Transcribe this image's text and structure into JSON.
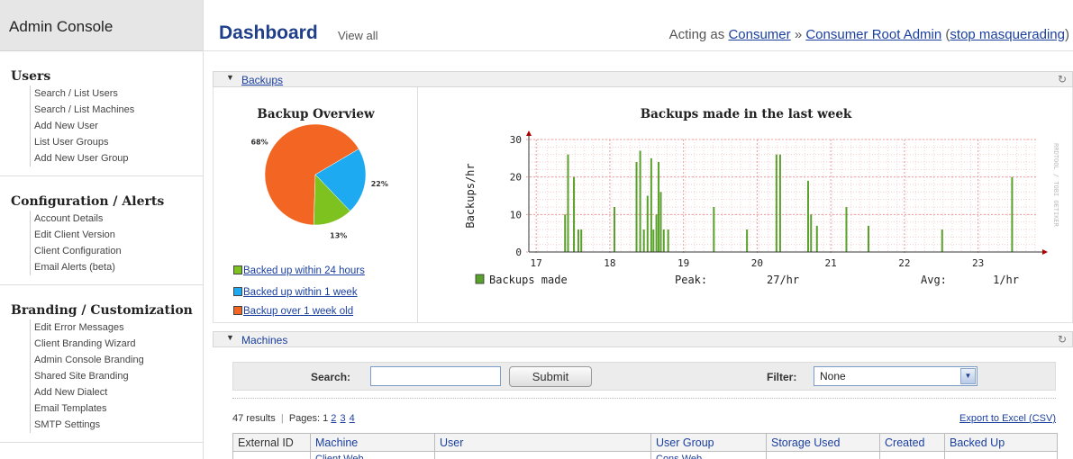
{
  "sidebar": {
    "title": "Admin Console",
    "sections": [
      {
        "heading": "Users",
        "items": [
          "Search / List Users",
          "Search / List Machines",
          "Add New User",
          "List User Groups",
          "Add New User Group"
        ]
      },
      {
        "heading": "Configuration / Alerts",
        "items": [
          "Account Details",
          "Edit Client Version",
          "Client Configuration",
          "Email Alerts (beta)"
        ]
      },
      {
        "heading": "Branding / Customization",
        "items": [
          "Edit Error Messages",
          "Client Branding Wizard",
          "Admin Console Branding",
          "Shared Site Branding",
          "Add New Dialect",
          "Email Templates",
          "SMTP Settings"
        ]
      }
    ]
  },
  "header": {
    "title": "Dashboard",
    "view_all": "View all",
    "acting_prefix": "Acting as",
    "acting_user": "Consumer",
    "acting_sep": "»",
    "acting_role": "Consumer Root Admin",
    "stop_label": "stop masquerading"
  },
  "backups": {
    "panel_label": "Backups",
    "overview_title": "Backup Overview",
    "pie": {
      "slices": [
        {
          "label": "68%",
          "value": 68,
          "color": "#f26522"
        },
        {
          "label": "22%",
          "value": 22,
          "color": "#1eaaf1"
        },
        {
          "label": "13%",
          "value": 13,
          "color": "#7dc21e"
        }
      ]
    },
    "legend": [
      {
        "label": "Backed up within 24 hours",
        "color": "#7dc21e"
      },
      {
        "label": "Backed up within 1 week",
        "color": "#1eaaf1"
      },
      {
        "label": "Backup over 1 week old",
        "color": "#f26522"
      }
    ]
  },
  "chart_data": {
    "type": "bar",
    "title": "Backups made in the last week",
    "ylabel": "Backups/hr",
    "ylim": [
      0,
      30
    ],
    "yticks": [
      0,
      10,
      20,
      30
    ],
    "xlim": [
      16.9,
      23.8
    ],
    "xticks": [
      "17",
      "18",
      "19",
      "20",
      "21",
      "22",
      "23"
    ],
    "watermark": "RRDTOOL / TOBI OETIKER",
    "series": [
      {
        "name": "Backups made",
        "color": "#5aa02c",
        "x": [
          17.38,
          17.42,
          17.5,
          17.56,
          17.6,
          18.05,
          18.35,
          18.4,
          18.45,
          18.5,
          18.55,
          18.58,
          18.62,
          18.65,
          18.68,
          18.72,
          18.78,
          19.4,
          19.85,
          20.25,
          20.3,
          20.68,
          20.72,
          20.8,
          21.2,
          21.5,
          22.5,
          23.45
        ],
        "values": [
          10,
          26,
          20,
          6,
          6,
          12,
          24,
          27,
          6,
          15,
          25,
          6,
          10,
          24,
          16,
          6,
          6,
          12,
          6,
          26,
          26,
          19,
          10,
          7,
          12,
          7,
          6,
          20
        ]
      }
    ],
    "legend_row": {
      "swatch_label": "Backups made",
      "peak_label": "Peak:",
      "peak_value": "27/hr",
      "avg_label": "Avg:",
      "avg_value": "1/hr"
    }
  },
  "machines": {
    "panel_label": "Machines",
    "search_label": "Search:",
    "search_value": "",
    "submit_label": "Submit",
    "filter_label": "Filter:",
    "filter_value": "None",
    "results_text": "47 results",
    "pages_label": "Pages: 1",
    "pages": [
      "2",
      "3",
      "4"
    ],
    "export_label": "Export to Excel (CSV)",
    "columns": [
      "External ID",
      "Machine",
      "User",
      "User Group",
      "Storage Used",
      "Created",
      "Backed Up"
    ],
    "first_row": [
      "",
      "Client Web",
      "",
      "Cons Web",
      "",
      "",
      ""
    ]
  },
  "colors": {
    "accent": "#1f3f8a",
    "link": "#1a3f9e",
    "bar": "#5aa02c"
  },
  "icons": {
    "collapse": "triangle-down-icon",
    "refresh": "refresh-icon",
    "dropdown": "chevron-down-icon"
  }
}
